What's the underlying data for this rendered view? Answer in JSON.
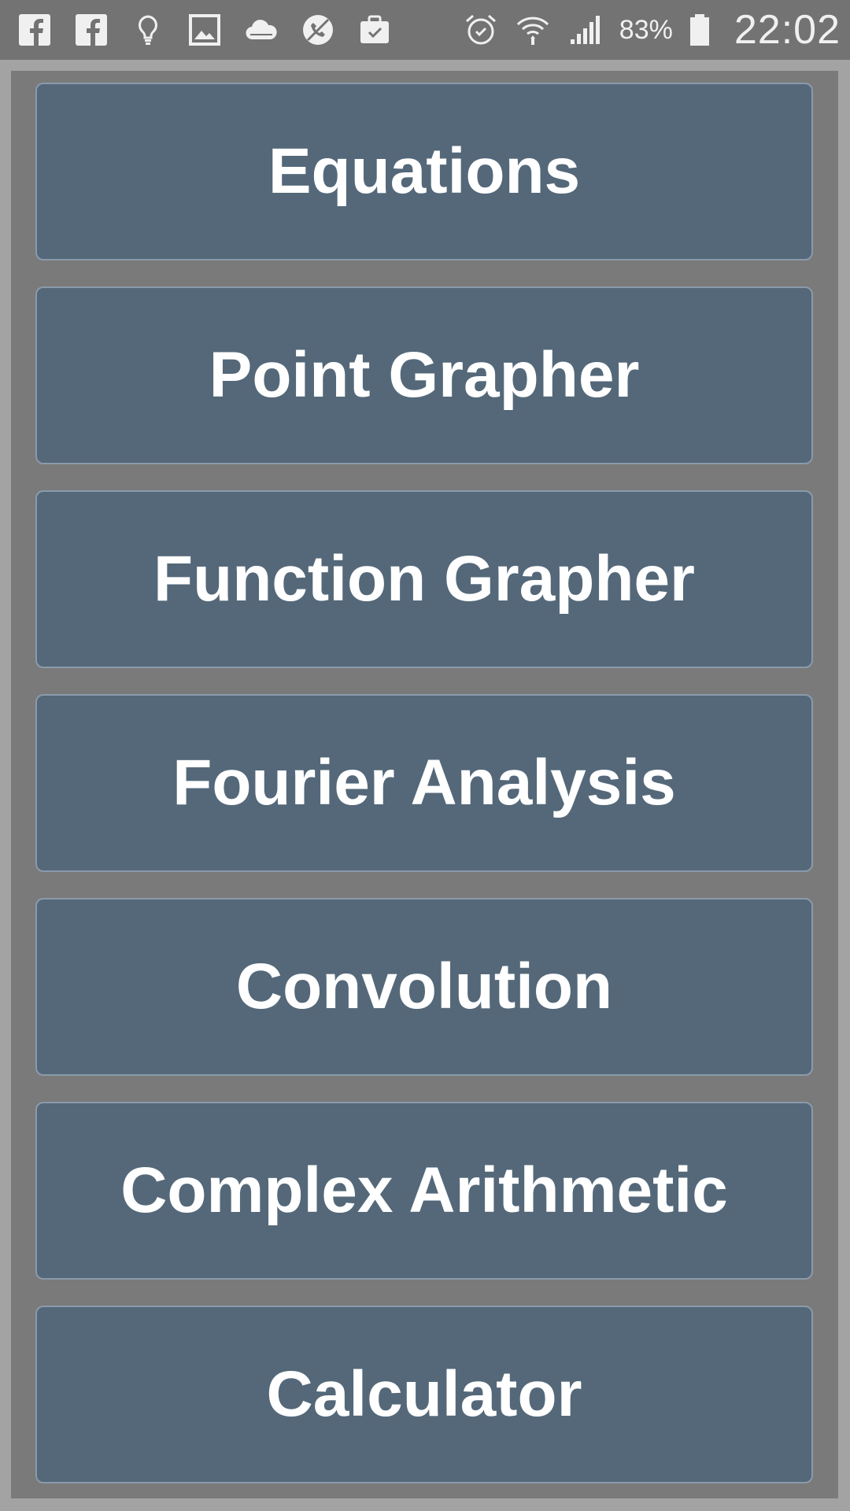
{
  "status_bar": {
    "left_icons": [
      "facebook-icon",
      "facebook-icon",
      "lightbulb-icon",
      "gallery-icon",
      "cloud-icon",
      "no-call-icon",
      "briefcase-check-icon"
    ],
    "right_icons": [
      "alarm-icon",
      "wifi-icon",
      "signal-icon",
      "battery-icon"
    ],
    "battery_percent": "83%",
    "time": "22:02"
  },
  "menu": {
    "items": [
      {
        "label": "Equations"
      },
      {
        "label": "Point Grapher"
      },
      {
        "label": "Function Grapher"
      },
      {
        "label": "Fourier Analysis"
      },
      {
        "label": "Convolution"
      },
      {
        "label": "Complex Arithmetic"
      },
      {
        "label": "Calculator"
      }
    ]
  },
  "colors": {
    "status_bar_bg": "#737373",
    "page_bg": "#7a7a7a",
    "frame_bg": "#a3a3a3",
    "button_bg": "#546879",
    "button_border": "#8a9aab",
    "button_text": "#ffffff"
  }
}
